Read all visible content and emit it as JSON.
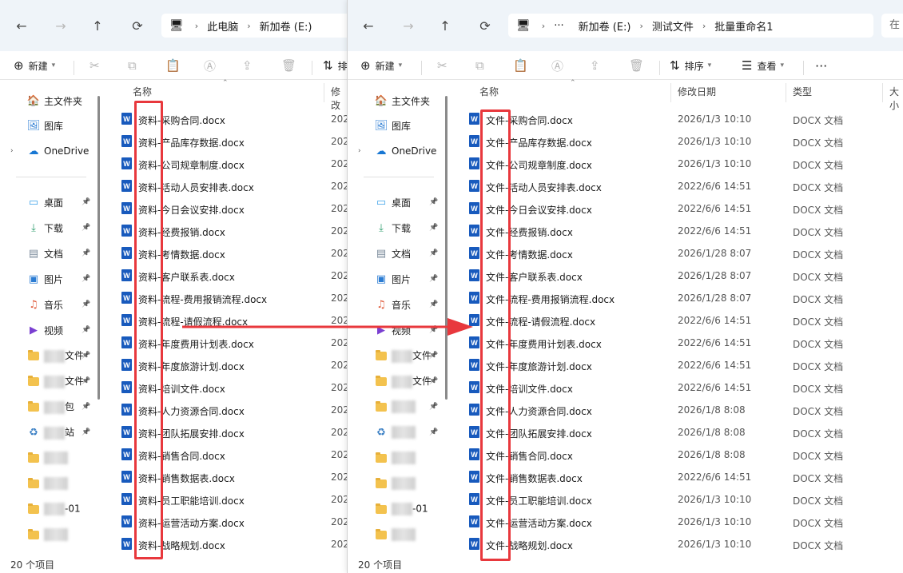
{
  "left": {
    "nav": {
      "back": "←",
      "forward": "→",
      "up": "↑",
      "refresh": "⟳"
    },
    "address": {
      "pc_icon": "computer-icon",
      "crumbs": [
        "此电脑",
        "新加卷 (E:)"
      ]
    },
    "toolbar": {
      "new_label": "新建",
      "sort_label": "排"
    },
    "sidebar": {
      "top": [
        {
          "label": "主文件夹",
          "icon": "home-icon"
        },
        {
          "label": "图库",
          "icon": "gallery-icon"
        },
        {
          "label": "OneDrive",
          "icon": "cloud-icon"
        }
      ],
      "pinned": [
        {
          "label": "桌面",
          "icon": "desktop-icon"
        },
        {
          "label": "下载",
          "icon": "download-icon"
        },
        {
          "label": "文档",
          "icon": "document-icon"
        },
        {
          "label": "图片",
          "icon": "picture-icon"
        },
        {
          "label": "音乐",
          "icon": "music-icon"
        },
        {
          "label": "视频",
          "icon": "video-icon"
        },
        {
          "label": "文件",
          "icon": "folder-icon"
        },
        {
          "label": "文件",
          "icon": "folder-icon"
        },
        {
          "label": "包",
          "icon": "folder-icon"
        },
        {
          "label": "站",
          "icon": "recycle-icon"
        },
        {
          "label": "",
          "icon": "folder-icon"
        },
        {
          "label": "",
          "icon": "folder-icon"
        },
        {
          "label": "-01",
          "icon": "folder-icon"
        },
        {
          "label": "",
          "icon": "folder-icon"
        }
      ]
    },
    "columns": {
      "name": "名称",
      "modified": "修改"
    },
    "files": [
      {
        "name": "资料-采购合同.docx",
        "date": "202"
      },
      {
        "name": "资料-产品库存数据.docx",
        "date": "202"
      },
      {
        "name": "资料-公司规章制度.docx",
        "date": "202"
      },
      {
        "name": "资料-活动人员安排表.docx",
        "date": "202"
      },
      {
        "name": "资料-今日会议安排.docx",
        "date": "202"
      },
      {
        "name": "资料-经费报销.docx",
        "date": "202"
      },
      {
        "name": "资料-考情数据.docx",
        "date": "202"
      },
      {
        "name": "资料-客户联系表.docx",
        "date": "202"
      },
      {
        "name": "资料-流程-费用报销流程.docx",
        "date": "202"
      },
      {
        "name": "资料-流程-请假流程.docx",
        "date": "202"
      },
      {
        "name": "资料-年度费用计划表.docx",
        "date": "202"
      },
      {
        "name": "资料-年度旅游计划.docx",
        "date": "202"
      },
      {
        "name": "资料-培训文件.docx",
        "date": "202"
      },
      {
        "name": "资料-人力资源合同.docx",
        "date": "202"
      },
      {
        "name": "资料-团队拓展安排.docx",
        "date": "202"
      },
      {
        "name": "资料-销售合同.docx",
        "date": "202"
      },
      {
        "name": "资料-销售数据表.docx",
        "date": "202"
      },
      {
        "name": "资料-员工职能培训.docx",
        "date": "202"
      },
      {
        "name": "资料-运营活动方案.docx",
        "date": "202"
      },
      {
        "name": "资料-战略规划.docx",
        "date": "202"
      }
    ],
    "status": "20 个项目"
  },
  "right": {
    "nav": {
      "back": "←",
      "forward": "→",
      "up": "↑",
      "refresh": "⟳"
    },
    "address": {
      "pc_icon": "computer-icon",
      "ellipsis": "···",
      "crumbs": [
        "新加卷 (E:)",
        "测试文件",
        "批量重命名1"
      ]
    },
    "search_text": "在",
    "toolbar": {
      "new_label": "新建",
      "sort_label": "排序",
      "view_label": "查看",
      "more": "···"
    },
    "sidebar": {
      "top": [
        {
          "label": "主文件夹",
          "icon": "home-icon"
        },
        {
          "label": "图库",
          "icon": "gallery-icon"
        },
        {
          "label": "OneDrive",
          "icon": "cloud-icon"
        }
      ],
      "pinned": [
        {
          "label": "桌面",
          "icon": "desktop-icon"
        },
        {
          "label": "下载",
          "icon": "download-icon"
        },
        {
          "label": "文档",
          "icon": "document-icon"
        },
        {
          "label": "图片",
          "icon": "picture-icon"
        },
        {
          "label": "音乐",
          "icon": "music-icon"
        },
        {
          "label": "视频",
          "icon": "video-icon"
        },
        {
          "label": "文件",
          "icon": "folder-icon"
        },
        {
          "label": "文件",
          "icon": "folder-icon"
        },
        {
          "label": "",
          "icon": "folder-icon"
        },
        {
          "label": "",
          "icon": "recycle-icon"
        },
        {
          "label": "",
          "icon": "folder-icon"
        },
        {
          "label": "",
          "icon": "folder-icon"
        },
        {
          "label": "-01",
          "icon": "folder-icon"
        },
        {
          "label": "",
          "icon": "folder-icon"
        }
      ]
    },
    "columns": {
      "name": "名称",
      "modified": "修改日期",
      "type": "类型",
      "size": "大小"
    },
    "files": [
      {
        "name": "文件-采购合同.docx",
        "date": "2026/1/3 10:10",
        "type": "DOCX 文档"
      },
      {
        "name": "文件-产品库存数据.docx",
        "date": "2026/1/3 10:10",
        "type": "DOCX 文档"
      },
      {
        "name": "文件-公司规章制度.docx",
        "date": "2026/1/3 10:10",
        "type": "DOCX 文档"
      },
      {
        "name": "文件-活动人员安排表.docx",
        "date": "2022/6/6 14:51",
        "type": "DOCX 文档"
      },
      {
        "name": "文件-今日会议安排.docx",
        "date": "2022/6/6 14:51",
        "type": "DOCX 文档"
      },
      {
        "name": "文件-经费报销.docx",
        "date": "2022/6/6 14:51",
        "type": "DOCX 文档"
      },
      {
        "name": "文件-考情数据.docx",
        "date": "2026/1/28 8:07",
        "type": "DOCX 文档"
      },
      {
        "name": "文件-客户联系表.docx",
        "date": "2026/1/28 8:07",
        "type": "DOCX 文档"
      },
      {
        "name": "文件-流程-费用报销流程.docx",
        "date": "2026/1/28 8:07",
        "type": "DOCX 文档"
      },
      {
        "name": "文件-流程-请假流程.docx",
        "date": "2022/6/6 14:51",
        "type": "DOCX 文档"
      },
      {
        "name": "文件-年度费用计划表.docx",
        "date": "2022/6/6 14:51",
        "type": "DOCX 文档"
      },
      {
        "name": "文件-年度旅游计划.docx",
        "date": "2022/6/6 14:51",
        "type": "DOCX 文档"
      },
      {
        "name": "文件-培训文件.docx",
        "date": "2022/6/6 14:51",
        "type": "DOCX 文档"
      },
      {
        "name": "文件-人力资源合同.docx",
        "date": "2026/1/8 8:08",
        "type": "DOCX 文档"
      },
      {
        "name": "文件-团队拓展安排.docx",
        "date": "2026/1/8 8:08",
        "type": "DOCX 文档"
      },
      {
        "name": "文件-销售合同.docx",
        "date": "2026/1/8 8:08",
        "type": "DOCX 文档"
      },
      {
        "name": "文件-销售数据表.docx",
        "date": "2022/6/6 14:51",
        "type": "DOCX 文档"
      },
      {
        "name": "文件-员工职能培训.docx",
        "date": "2026/1/3 10:10",
        "type": "DOCX 文档"
      },
      {
        "name": "文件-运营活动方案.docx",
        "date": "2026/1/3 10:10",
        "type": "DOCX 文档"
      },
      {
        "name": "文件-战略规划.docx",
        "date": "2026/1/3 10:10",
        "type": "DOCX 文档"
      }
    ],
    "status": "20 个项目"
  },
  "colors": {
    "highlight": "#e8383d",
    "word_blue": "#185abd",
    "addrbar_bg": "#eff4f9",
    "folder": "#f3c24e"
  },
  "icons": {
    "file": "word-doc-icon",
    "pin": "pin-icon",
    "arrow": "arrow-right-icon"
  }
}
